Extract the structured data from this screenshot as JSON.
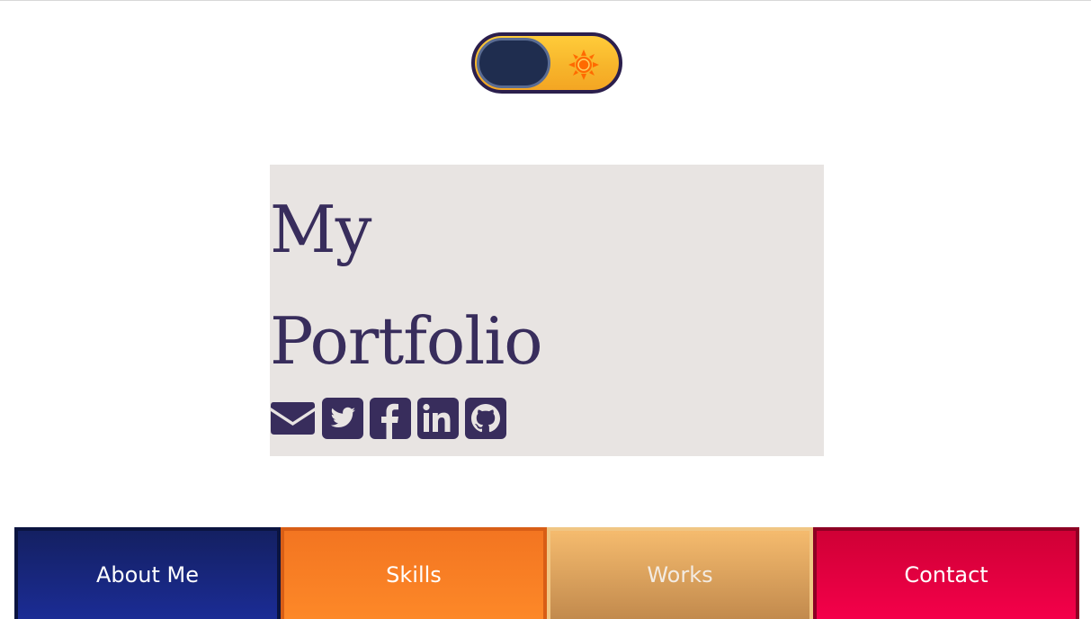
{
  "theme_toggle": {
    "state": "light",
    "icon": "sun-icon",
    "colors": {
      "track": "#f7b52b",
      "knob": "#1f2d4f",
      "sun": "#ff6a00"
    }
  },
  "hero": {
    "title_line1": "My",
    "title_line2": "Portfolio",
    "title_color": "#382d5c",
    "social_icons": [
      "email-icon",
      "twitter-icon",
      "facebook-icon",
      "linkedin-icon",
      "github-icon"
    ]
  },
  "nav": {
    "about": "About Me",
    "skills": "Skills",
    "works": "Works",
    "contact": "Contact",
    "colors": {
      "about": "#1b2c95",
      "skills": "#fd8828",
      "works": "#d9a05c",
      "contact": "#f4004a"
    }
  }
}
